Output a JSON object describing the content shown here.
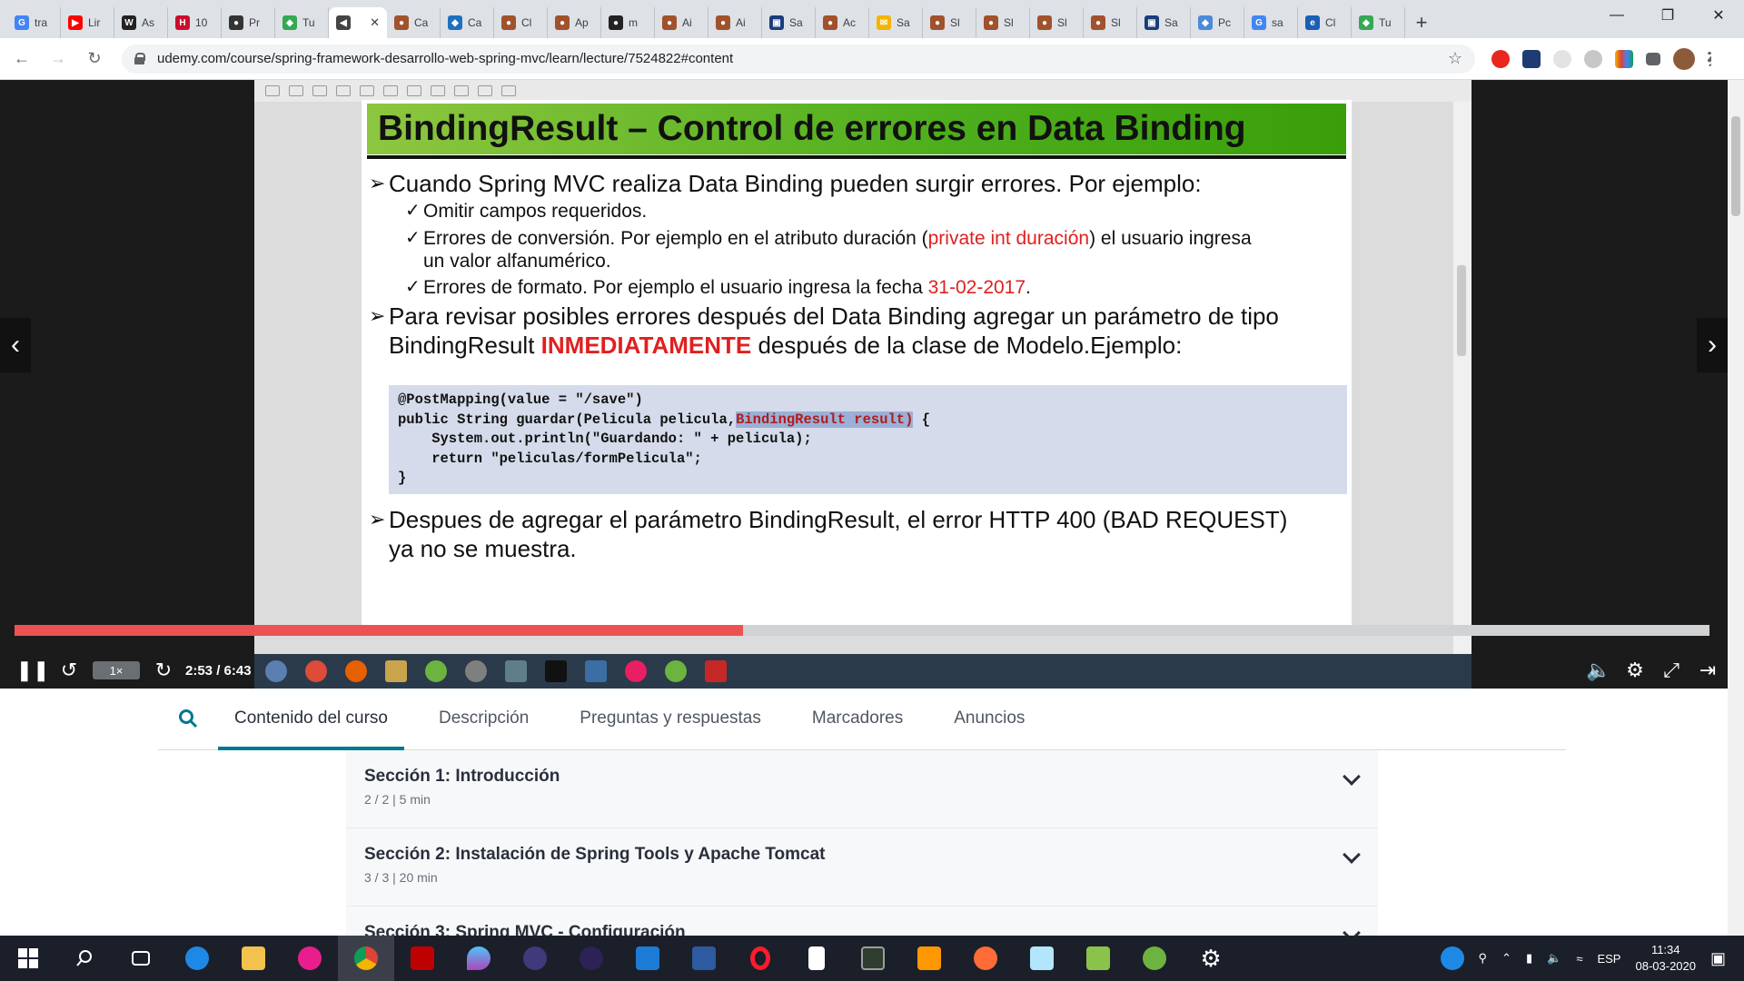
{
  "browser": {
    "tabs": [
      {
        "label": "tra",
        "color": "#4285f4",
        "glyph": "G"
      },
      {
        "label": "Lir",
        "color": "#ff0000",
        "glyph": "▶"
      },
      {
        "label": "As",
        "color": "#222222",
        "glyph": "W"
      },
      {
        "label": "10",
        "color": "#c8102e",
        "glyph": "H"
      },
      {
        "label": "Pr",
        "color": "#333333",
        "glyph": "●"
      },
      {
        "label": "Tu",
        "color": "#34a853",
        "glyph": "◆"
      },
      {
        "label": "",
        "color": "#444444",
        "glyph": "◀",
        "active": true
      },
      {
        "label": "Ca",
        "color": "#a0522d",
        "glyph": "●"
      },
      {
        "label": "Ca",
        "color": "#1e70bf",
        "glyph": "◆"
      },
      {
        "label": "Cl",
        "color": "#a0522d",
        "glyph": "●"
      },
      {
        "label": "Ap",
        "color": "#a0522d",
        "glyph": "●"
      },
      {
        "label": "m",
        "color": "#222222",
        "glyph": "●"
      },
      {
        "label": "Ai",
        "color": "#a0522d",
        "glyph": "●"
      },
      {
        "label": "Ai",
        "color": "#a0522d",
        "glyph": "●"
      },
      {
        "label": "Sa",
        "color": "#1a3d7c",
        "glyph": "▣"
      },
      {
        "label": "Ac",
        "color": "#a0522d",
        "glyph": "●"
      },
      {
        "label": "Sa",
        "color": "#f4b400",
        "glyph": "✉"
      },
      {
        "label": "Sl",
        "color": "#a0522d",
        "glyph": "●"
      },
      {
        "label": "Sl",
        "color": "#a0522d",
        "glyph": "●"
      },
      {
        "label": "Sl",
        "color": "#a0522d",
        "glyph": "●"
      },
      {
        "label": "Sl",
        "color": "#a0522d",
        "glyph": "●"
      },
      {
        "label": "Sa",
        "color": "#1a3d7c",
        "glyph": "▣"
      },
      {
        "label": "Pc",
        "color": "#4a8ad8",
        "glyph": "◆"
      },
      {
        "label": "sa",
        "color": "#4285f4",
        "glyph": "G"
      },
      {
        "label": "Cl",
        "color": "#1a5fb4",
        "glyph": "e"
      },
      {
        "label": "Tu",
        "color": "#34a853",
        "glyph": "◆"
      }
    ],
    "url": "udemy.com/course/spring-framework-desarrollo-web-spring-mvc/learn/lecture/7524822#content"
  },
  "slide": {
    "title": "BindingResult – Control de errores en Data Binding",
    "bullet1": "Cuando Spring MVC realiza Data Binding pueden surgir errores. Por ejemplo:",
    "sub1": "Omitir campos requeridos.",
    "sub2_a": "Errores de conversión. Por ejemplo en el atributo duración (",
    "sub2_red": "private int duración",
    "sub2_b": ") el usuario ingresa",
    "sub2_c": "un valor alfanumérico.",
    "sub3_a": "Errores de formato. Por ejemplo el usuario ingresa la fecha ",
    "sub3_red": "31-02-2017",
    "sub3_b": ".",
    "bullet2_a": "Para revisar posibles errores después del Data Binding agregar un parámetro de tipo",
    "bullet2_b": "BindingResult ",
    "bullet2_red": "INMEDIATAMENTE",
    "bullet2_c": " después de la clase de Modelo.Ejemplo:",
    "code_l1": "@PostMapping(value = \"/save\")",
    "code_l2a": "public String guardar(Pelicula pelicula,",
    "code_l2hl": "BindingResult result)",
    "code_l2b": " {",
    "code_l3": "    System.out.println(\"Guardando: \" + pelicula);",
    "code_l4": "    return \"peliculas/formPelicula\";",
    "code_l5": "}",
    "bullet3_a": "Despues de agregar el parámetro BindingResult, el error HTTP 400 (BAD REQUEST)",
    "bullet3_b": "ya no se muestra."
  },
  "player": {
    "progress": 0.43,
    "speed": "1×",
    "time": "2:53 / 6:43"
  },
  "course": {
    "tabs": [
      "Contenido del curso",
      "Descripción",
      "Preguntas y respuestas",
      "Marcadores",
      "Anuncios"
    ],
    "sections": [
      {
        "title": "Sección 1: Introducción",
        "meta": "2 / 2  |  5 min"
      },
      {
        "title": "Sección 2: Instalación de Spring Tools y Apache Tomcat",
        "meta": "3 / 3  |  20 min"
      },
      {
        "title": "Sección 3: Spring MVC - Configuración",
        "meta": ""
      }
    ]
  },
  "taskbar": {
    "lang": "ESP",
    "time": "11:34",
    "date": "08-03-2020"
  }
}
